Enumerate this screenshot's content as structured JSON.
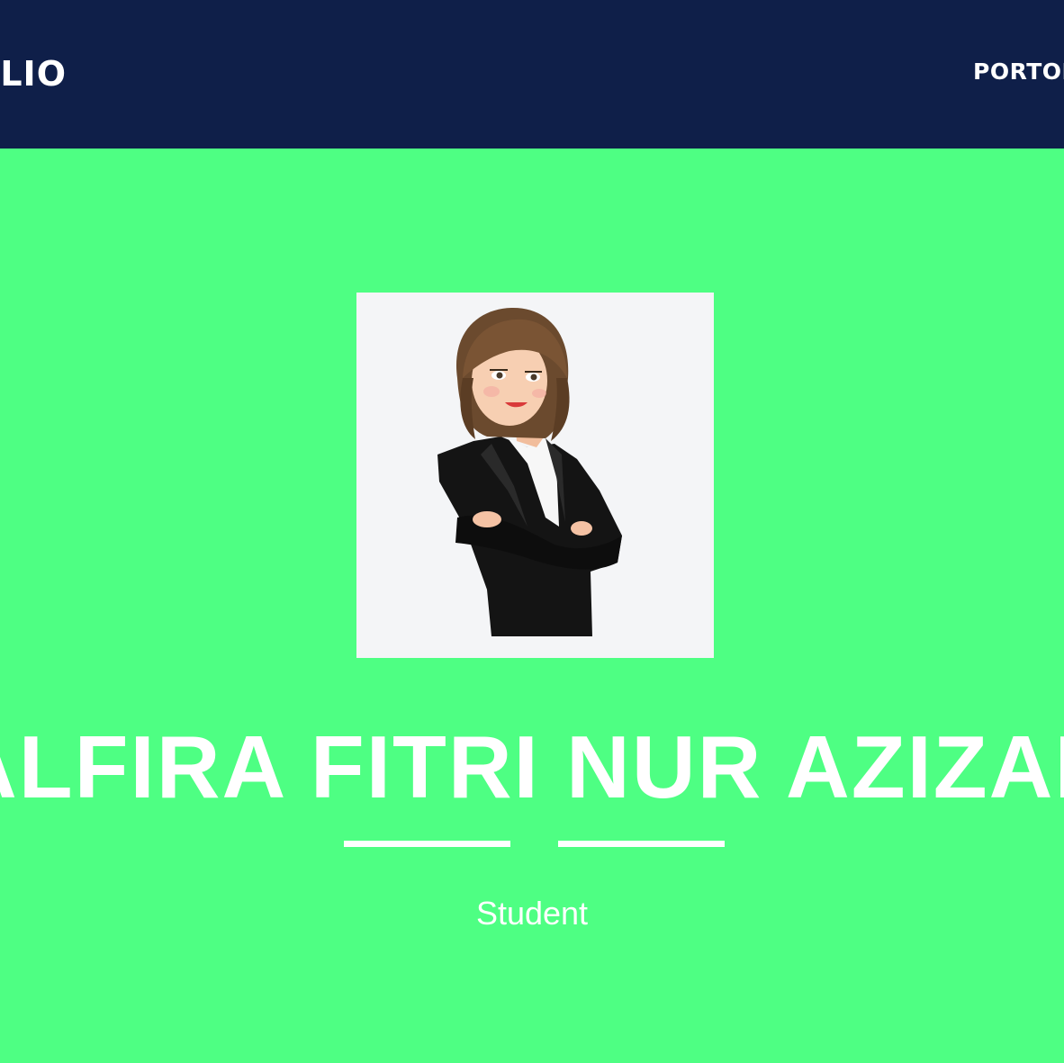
{
  "navbar": {
    "brand": "PORTFOLIO",
    "link": "PORTOFOLIO"
  },
  "hero": {
    "name": "ALFIRA FITRI NUR AZIZAH",
    "role": "Student",
    "avatar_icon": "businesswoman-avatar-icon"
  },
  "colors": {
    "navbar_bg": "#0f1f49",
    "hero_bg": "#4eff83",
    "text": "#ffffff"
  }
}
